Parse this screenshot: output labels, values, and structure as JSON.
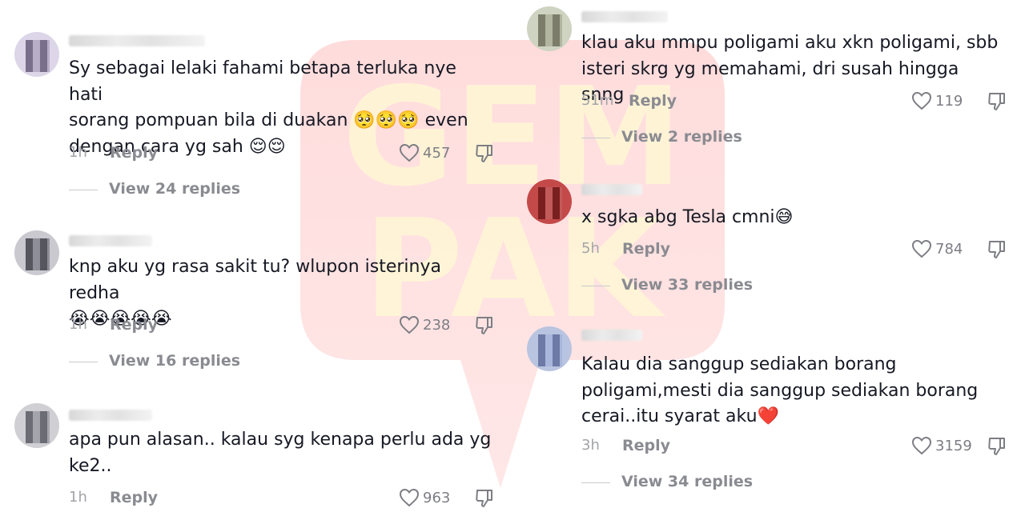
{
  "watermark": {
    "text_top": "GEM",
    "text_bottom": "PAK",
    "color": "#ff6b6b"
  },
  "left_comments": [
    {
      "text": "Sy sebagai lelaki fahami betapa terluka nye hati\nsorang pompuan bila di duakan 🥺🥺🥺 even\ndengan cara yg sah 😌😌",
      "time": "1h",
      "reply": "Reply",
      "likes": "457",
      "view_replies": "View 24 replies"
    },
    {
      "text": "knp aku yg rasa sakit tu? wlupon isterinya redha\n😭😭😭😭😭",
      "time": "1h",
      "reply": "Reply",
      "likes": "238",
      "view_replies": "View 16 replies"
    },
    {
      "text": "apa pun alasan.. kalau syg kenapa perlu ada yg\nke2..",
      "time": "1h",
      "reply": "Reply",
      "likes": "963",
      "view_replies": ""
    }
  ],
  "right_comments": [
    {
      "text": "klau aku mmpu poligami aku xkn poligami, sbb\nisteri skrg yg memahami, dri susah hingga snng",
      "time": "51m",
      "reply": "Reply",
      "likes": "119",
      "view_replies": "View 2 replies"
    },
    {
      "text": "x sgka abg Tesla cmni😅",
      "time": "5h",
      "reply": "Reply",
      "likes": "784",
      "view_replies": "View 33 replies"
    },
    {
      "text": "Kalau dia sanggup sediakan borang\npoligami,mesti dia sanggup sediakan borang\ncerai..itu syarat aku❤️",
      "time": "3h",
      "reply": "Reply",
      "likes": "3159",
      "view_replies": "View 34 replies"
    }
  ],
  "icons": {
    "like": "heart-outline-icon",
    "dislike": "thumbs-down-icon"
  },
  "colors": {
    "text": "#161823",
    "muted": "#8a8b91",
    "time": "#a3a4a8"
  }
}
